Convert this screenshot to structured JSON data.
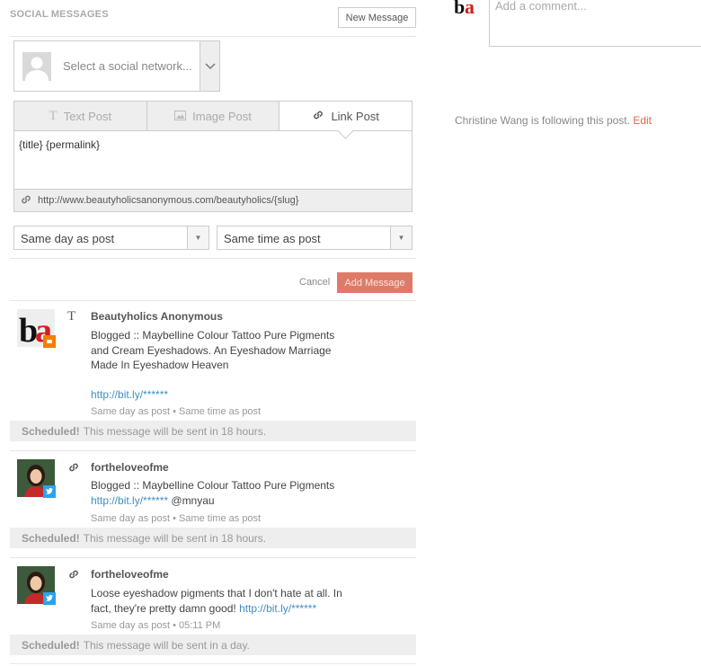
{
  "header": {
    "title": "SOCIAL MESSAGES",
    "new_message": "New Message"
  },
  "network_select": {
    "placeholder": "Select a social network..."
  },
  "tabs": [
    {
      "label": "Text Post",
      "icon": "text-icon"
    },
    {
      "label": "Image Post",
      "icon": "image-icon"
    },
    {
      "label": "Link Post",
      "icon": "link-icon",
      "active": true
    }
  ],
  "editor": {
    "value": "{title} {permalink}",
    "link_url": "http://www.beautyholicsanonymous.com/beautyholics/{slug}"
  },
  "schedule": {
    "day": "Same day as post",
    "time": "Same time as post"
  },
  "actions": {
    "cancel": "Cancel",
    "add": "Add Message"
  },
  "messages": [
    {
      "name": "Beautyholics Anonymous",
      "type": "text",
      "text": "Blogged :: Maybelline Colour Tattoo Pure Pigments and Cream Eyeshadows. An Eyeshadow Marriage Made In Eyeshadow Heaven",
      "link": "http://bit.ly/******",
      "meta": "Same day as post • Same time as post",
      "sched_label": "Scheduled!",
      "sched_text": "This message will be sent in 18 hours."
    },
    {
      "name": "fortheloveofme",
      "type": "link",
      "text": "Blogged :: Maybelline Colour Tattoo Pure Pigments",
      "link": "http://bit.ly/******",
      "after_link": " @mnyau",
      "meta": "Same day as post • Same time as post",
      "sched_label": "Scheduled!",
      "sched_text": "This message will be sent in 18 hours."
    },
    {
      "name": "fortheloveofme",
      "type": "link",
      "text": "Loose eyeshadow pigments that I don't hate at all. In fact, they're pretty damn good!",
      "link": "http://bit.ly/******",
      "meta": "Same day as post • 05:11 PM",
      "sched_label": "Scheduled!",
      "sched_text": "This message will be sent in a day."
    }
  ],
  "right": {
    "comment_placeholder": "Add a comment...",
    "following": "Christine Wang is following this post.",
    "edit": "Edit"
  },
  "colors": {
    "accent": "#de7b68",
    "link": "#3e8fc1",
    "twitter": "#2aa3ef",
    "blogger": "#f57d00"
  }
}
